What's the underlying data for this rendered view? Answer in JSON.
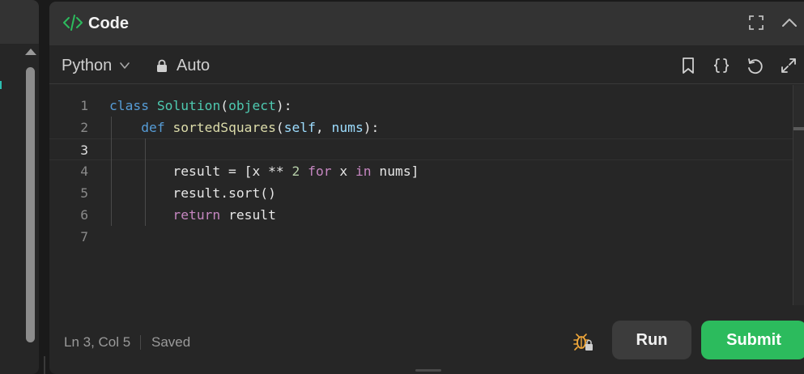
{
  "panel": {
    "title": "Code"
  },
  "toolbar": {
    "language": "Python",
    "mode": "Auto"
  },
  "editor": {
    "current_line": 3,
    "lines": [
      {
        "number": "1"
      },
      {
        "number": "2"
      },
      {
        "number": "3"
      },
      {
        "number": "4"
      },
      {
        "number": "5"
      },
      {
        "number": "6"
      },
      {
        "number": "7"
      }
    ],
    "tokens": {
      "class_kw": "class",
      "class_name": "Solution",
      "base_class": "object",
      "def_kw": "def",
      "func_name": "sortedSquares",
      "param_self": "self",
      "param_nums": "nums",
      "result_var": "result",
      "x_var": "x",
      "power_op": "**",
      "two": "2",
      "for_kw": "for",
      "in_kw": "in",
      "sort_method": "sort",
      "return_kw": "return"
    }
  },
  "status": {
    "position": "Ln 3, Col 5",
    "saved": "Saved"
  },
  "actions": {
    "run": "Run",
    "submit": "Submit"
  },
  "colors": {
    "accent_green": "#2cbb5d",
    "keyword_blue": "#569cd6",
    "keyword_purple": "#c586c0",
    "class_teal": "#4ec9b0",
    "function_yellow": "#dcdcaa",
    "variable_blue": "#9cdcfe",
    "number_green": "#b5cea8"
  },
  "icons": [
    "code-icon",
    "fullscreen-icon",
    "collapse-chevron-icon",
    "chevron-down-icon",
    "lock-icon",
    "bookmark-icon",
    "braces-icon",
    "reset-icon",
    "expand-icon",
    "debug-icon"
  ]
}
